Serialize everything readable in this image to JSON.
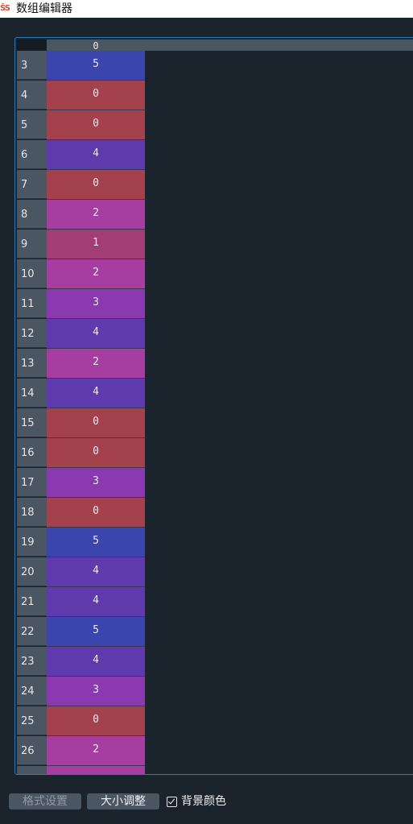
{
  "window": {
    "title": "数组编辑器",
    "icon": "app-logo-icon"
  },
  "grid": {
    "column_headers": [
      "0"
    ],
    "rows": [
      {
        "index": "3",
        "value": "5",
        "color": "#3a45ae"
      },
      {
        "index": "4",
        "value": "0",
        "color": "#a3414c"
      },
      {
        "index": "5",
        "value": "0",
        "color": "#a3414c"
      },
      {
        "index": "6",
        "value": "4",
        "color": "#5e3aac"
      },
      {
        "index": "7",
        "value": "0",
        "color": "#a3414c"
      },
      {
        "index": "8",
        "value": "2",
        "color": "#a63ea1"
      },
      {
        "index": "9",
        "value": "1",
        "color": "#a33e75"
      },
      {
        "index": "10",
        "value": "2",
        "color": "#a63ea1"
      },
      {
        "index": "11",
        "value": "3",
        "color": "#8a3aae"
      },
      {
        "index": "12",
        "value": "4",
        "color": "#5e3aac"
      },
      {
        "index": "13",
        "value": "2",
        "color": "#a63ea1"
      },
      {
        "index": "14",
        "value": "4",
        "color": "#5e3aac"
      },
      {
        "index": "15",
        "value": "0",
        "color": "#a3414c"
      },
      {
        "index": "16",
        "value": "0",
        "color": "#a3414c"
      },
      {
        "index": "17",
        "value": "3",
        "color": "#8a3aae"
      },
      {
        "index": "18",
        "value": "0",
        "color": "#a3414c"
      },
      {
        "index": "19",
        "value": "5",
        "color": "#3a45ae"
      },
      {
        "index": "20",
        "value": "4",
        "color": "#5e3aac"
      },
      {
        "index": "21",
        "value": "4",
        "color": "#5e3aac"
      },
      {
        "index": "22",
        "value": "5",
        "color": "#3a45ae"
      },
      {
        "index": "23",
        "value": "4",
        "color": "#5e3aac"
      },
      {
        "index": "24",
        "value": "3",
        "color": "#8a3aae"
      },
      {
        "index": "25",
        "value": "0",
        "color": "#a3414c"
      },
      {
        "index": "26",
        "value": "2",
        "color": "#a63ea1"
      },
      {
        "index": "",
        "value": "",
        "color": "#a63ea1"
      }
    ]
  },
  "toolbar": {
    "format_label": "格式设置",
    "resize_label": "大小调整",
    "bg_color_label": "背景颜色",
    "bg_color_checked": true
  },
  "colors": {
    "background": "#1b232d",
    "header": "#4b5663",
    "frame_border": "#2f78b8"
  }
}
